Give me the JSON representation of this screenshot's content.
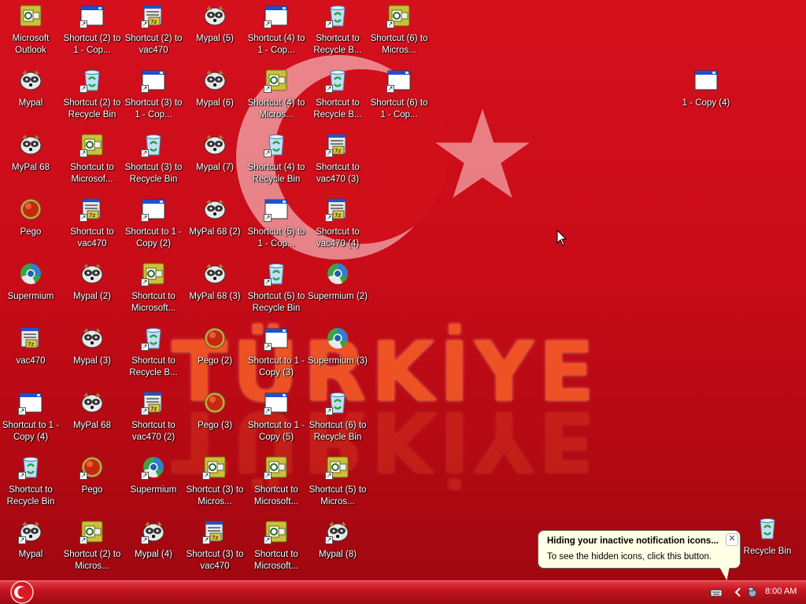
{
  "wallpaper": {
    "text": "TÜRKİYE"
  },
  "icons": [
    {
      "label": "Microsoft Outlook",
      "type": "outlook",
      "shortcut": false
    },
    {
      "label": "Shortcut (2) to 1 - Cop...",
      "type": "window",
      "shortcut": true
    },
    {
      "label": "Shortcut (2) to vac470",
      "type": "vac",
      "shortcut": true
    },
    {
      "label": "Mypal (5)",
      "type": "mypal",
      "shortcut": false
    },
    {
      "label": "Shortcut (4) to 1 - Cop...",
      "type": "window",
      "shortcut": true
    },
    {
      "label": "Shortcut to Recycle B...",
      "type": "recycle",
      "shortcut": true
    },
    {
      "label": "Shortcut (6) to Micros...",
      "type": "outlook",
      "shortcut": true
    },
    {
      "label": "Mypal",
      "type": "mypal",
      "shortcut": false
    },
    {
      "label": "Shortcut (2) to Recycle Bin",
      "type": "recycle",
      "shortcut": true
    },
    {
      "label": "Shortcut (3) to 1 - Cop...",
      "type": "window",
      "shortcut": true
    },
    {
      "label": "Mypal (6)",
      "type": "mypal",
      "shortcut": false
    },
    {
      "label": "Shortcut (4) to Micros...",
      "type": "outlook",
      "shortcut": true
    },
    {
      "label": "Shortcut to Recycle B...",
      "type": "recycle",
      "shortcut": true
    },
    {
      "label": "Shortcut (6) to 1 - Cop...",
      "type": "window",
      "shortcut": true
    },
    {
      "label": "1 - Copy (4)",
      "type": "window",
      "shortcut": false
    },
    {
      "label": "MyPal 68",
      "type": "mypal",
      "shortcut": false
    },
    {
      "label": "Shortcut to Microsof...",
      "type": "outlook",
      "shortcut": true
    },
    {
      "label": "Shortcut (3) to Recycle Bin",
      "type": "recycle",
      "shortcut": true
    },
    {
      "label": "Mypal (7)",
      "type": "mypal",
      "shortcut": false
    },
    {
      "label": "Shortcut (4) to Recycle Bin",
      "type": "recycle",
      "shortcut": true
    },
    {
      "label": "Shortcut to vac470 (3)",
      "type": "vac",
      "shortcut": true
    },
    {
      "label": "Pego",
      "type": "pego",
      "shortcut": false
    },
    {
      "label": "Shortcut to vac470",
      "type": "vac",
      "shortcut": true
    },
    {
      "label": "Shortcut to 1 - Copy (2)",
      "type": "window",
      "shortcut": true
    },
    {
      "label": "MyPal 68 (2)",
      "type": "mypal",
      "shortcut": false
    },
    {
      "label": "Shortcut (5) to 1 - Cop...",
      "type": "window",
      "shortcut": true
    },
    {
      "label": "Shortcut to vac470 (4)",
      "type": "vac",
      "shortcut": true
    },
    {
      "label": "Supermium",
      "type": "supermium",
      "shortcut": false
    },
    {
      "label": "Mypal (2)",
      "type": "mypal",
      "shortcut": false
    },
    {
      "label": "Shortcut to Microsoft...",
      "type": "outlook",
      "shortcut": true
    },
    {
      "label": "MyPal 68 (3)",
      "type": "mypal",
      "shortcut": false
    },
    {
      "label": "Shortcut (5) to Recycle Bin",
      "type": "recycle",
      "shortcut": true
    },
    {
      "label": "Supermium (2)",
      "type": "supermium",
      "shortcut": false
    },
    {
      "label": "vac470",
      "type": "vac",
      "shortcut": false
    },
    {
      "label": "Mypal (3)",
      "type": "mypal",
      "shortcut": false
    },
    {
      "label": "Shortcut to Recycle B...",
      "type": "recycle",
      "shortcut": true
    },
    {
      "label": "Pego (2)",
      "type": "pego",
      "shortcut": false
    },
    {
      "label": "Shortcut to 1 - Copy (3)",
      "type": "window",
      "shortcut": true
    },
    {
      "label": "Supermium (3)",
      "type": "supermium",
      "shortcut": false
    },
    {
      "label": "Shortcut to 1 - Copy (4)",
      "type": "window",
      "shortcut": true
    },
    {
      "label": "MyPal 68",
      "type": "mypal",
      "shortcut": false
    },
    {
      "label": "Shortcut to vac470 (2)",
      "type": "vac",
      "shortcut": true
    },
    {
      "label": "Pego (3)",
      "type": "pego",
      "shortcut": false
    },
    {
      "label": "Shortcut to 1 - Copy (5)",
      "type": "window",
      "shortcut": true
    },
    {
      "label": "Shortcut (6) to Recycle Bin",
      "type": "recycle",
      "shortcut": true
    },
    {
      "label": "Shortcut to Recycle Bin",
      "type": "recycle",
      "shortcut": true
    },
    {
      "label": "Pego",
      "type": "pego",
      "shortcut": true
    },
    {
      "label": "Supermium",
      "type": "supermium",
      "shortcut": true
    },
    {
      "label": "Shortcut (3) to Micros...",
      "type": "outlook",
      "shortcut": true
    },
    {
      "label": "Shortcut to Microsoft...",
      "type": "outlook",
      "shortcut": true
    },
    {
      "label": "Shortcut (5) to Micros...",
      "type": "outlook",
      "shortcut": true
    },
    {
      "label": "Mypal",
      "type": "mypal",
      "shortcut": true
    },
    {
      "label": "Shortcut (2) to Micros...",
      "type": "outlook",
      "shortcut": true
    },
    {
      "label": "Mypal (4)",
      "type": "mypal",
      "shortcut": true
    },
    {
      "label": "Shortcut (3) to vac470",
      "type": "vac",
      "shortcut": true
    },
    {
      "label": "Shortcut to Microsoft...",
      "type": "outlook",
      "shortcut": true
    },
    {
      "label": "Mypal (8)",
      "type": "mypal",
      "shortcut": true
    },
    {
      "label": "Recycle Bin",
      "type": "recycle",
      "shortcut": false
    }
  ],
  "balloon": {
    "title": "Hiding your inactive notification icons...",
    "body": "To see the hidden icons, click this button."
  },
  "taskbar": {
    "clock": "8:00 AM"
  },
  "colors": {
    "wallpaper_red": "#c80c18",
    "crescent": "#f4c2c5",
    "text_orange": "#ff6a2a"
  }
}
